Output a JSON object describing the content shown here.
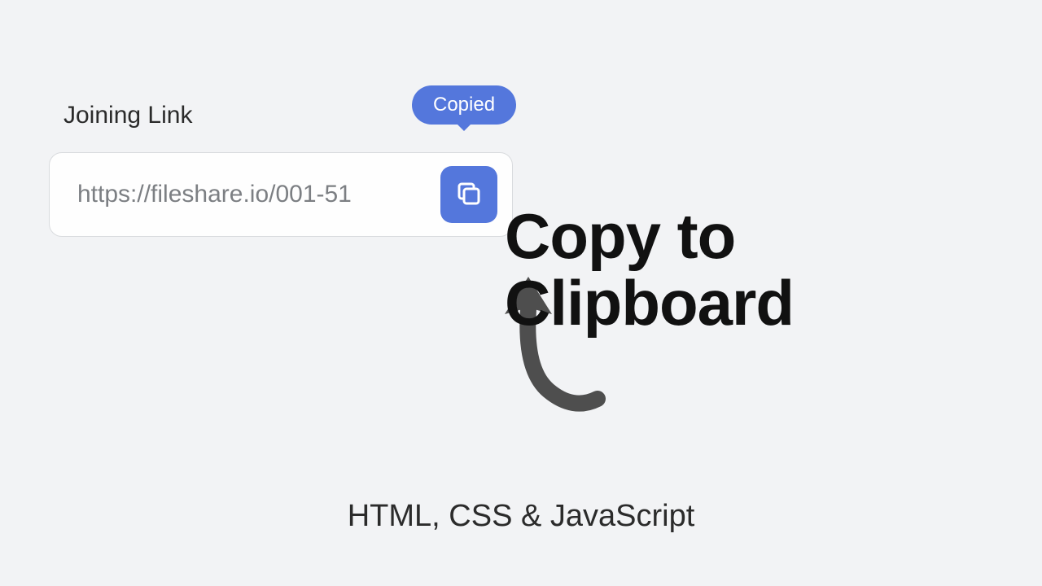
{
  "widget": {
    "label": "Joining Link",
    "tooltip": "Copied",
    "url": "https://fileshare.io/001-51"
  },
  "title": {
    "line1": "Copy to",
    "line2": "Clipboard"
  },
  "subtitle": "HTML, CSS & JavaScript"
}
